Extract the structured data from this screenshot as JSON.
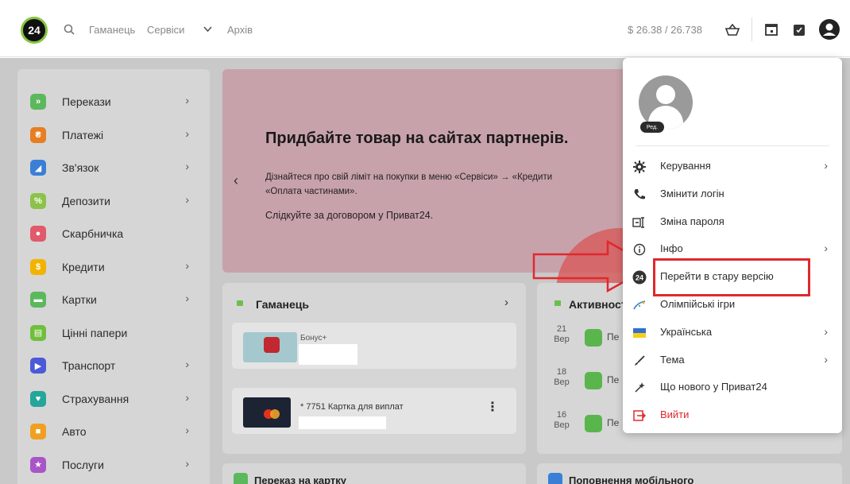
{
  "topbar": {
    "logo": "24",
    "nav": [
      "Гаманець",
      "Сервіси",
      "Архів"
    ],
    "rate": "$ 26.38 / 26.738"
  },
  "sidebar": {
    "items": [
      {
        "label": "Перекази",
        "color": "#5cb85c",
        "glyph": "»",
        "chev": true
      },
      {
        "label": "Платежі",
        "color": "#e67e22",
        "glyph": "₴",
        "chev": true
      },
      {
        "label": "Зв'язок",
        "color": "#3a7fd5",
        "glyph": "◢",
        "chev": true
      },
      {
        "label": "Депозити",
        "color": "#8bc34a",
        "glyph": "%",
        "chev": true
      },
      {
        "label": "Скарбничка",
        "color": "#e05a6b",
        "glyph": "●",
        "chev": false
      },
      {
        "label": "Кредити",
        "color": "#f0b400",
        "glyph": "$",
        "chev": true
      },
      {
        "label": "Картки",
        "color": "#5cb85c",
        "glyph": "▬",
        "chev": true
      },
      {
        "label": "Цінні папери",
        "color": "#6fbf3b",
        "glyph": "▤",
        "chev": false
      },
      {
        "label": "Транспорт",
        "color": "#4a5ad8",
        "glyph": "▶",
        "chev": true
      },
      {
        "label": "Страхування",
        "color": "#26a69a",
        "glyph": "♥",
        "chev": true
      },
      {
        "label": "Авто",
        "color": "#f0a020",
        "glyph": "■",
        "chev": true
      },
      {
        "label": "Послуги",
        "color": "#a855c7",
        "glyph": "★",
        "chev": true
      }
    ]
  },
  "promo": {
    "title": "Придбайте товар на сайтах партнерів.",
    "line1": "Дізнайтеся про свій ліміт на покупки в меню «Сервіси» → «Кредити",
    "line2": "«Оплата частинами».",
    "line3": "Слідкуйте за договором у Приват24."
  },
  "wallet": {
    "title": "Гаманець",
    "bonus_label": "Бонус+",
    "card_label": "* 7751  Картка для виплат"
  },
  "activity": {
    "title": "Активності",
    "rows": [
      {
        "day": "21",
        "month": "Вер",
        "text": "Пе"
      },
      {
        "day": "18",
        "month": "Вер",
        "text": "Пе"
      },
      {
        "day": "16",
        "month": "Вер",
        "text": "Пе"
      }
    ]
  },
  "bottom": {
    "left": "Переказ на картку",
    "right": "Поповнення мобільного"
  },
  "menu": {
    "avatar_edit": "Ред.",
    "items": [
      {
        "label": "Керування",
        "icon": "gear-icon",
        "chev": true
      },
      {
        "label": "Змінити логін",
        "icon": "phone-icon",
        "chev": false
      },
      {
        "label": "Зміна пароля",
        "icon": "key-icon",
        "chev": false
      },
      {
        "label": "Інфо",
        "icon": "info-icon",
        "chev": true
      },
      {
        "label": "Перейти в стару версію",
        "icon": "p24-icon",
        "chev": false
      },
      {
        "label": "Олімпійські ігри",
        "icon": "olympic-icon",
        "chev": false
      },
      {
        "label": "Українська",
        "icon": "flag-icon",
        "chev": true
      },
      {
        "label": "Тема",
        "icon": "brush-icon",
        "chev": true
      },
      {
        "label": "Що нового у Приват24",
        "icon": "sparkle-icon",
        "chev": false
      },
      {
        "label": "Вийти",
        "icon": "logout-icon",
        "chev": false
      }
    ]
  },
  "colors": {
    "accent_green": "#86c440",
    "highlight_red": "#e0282e"
  }
}
